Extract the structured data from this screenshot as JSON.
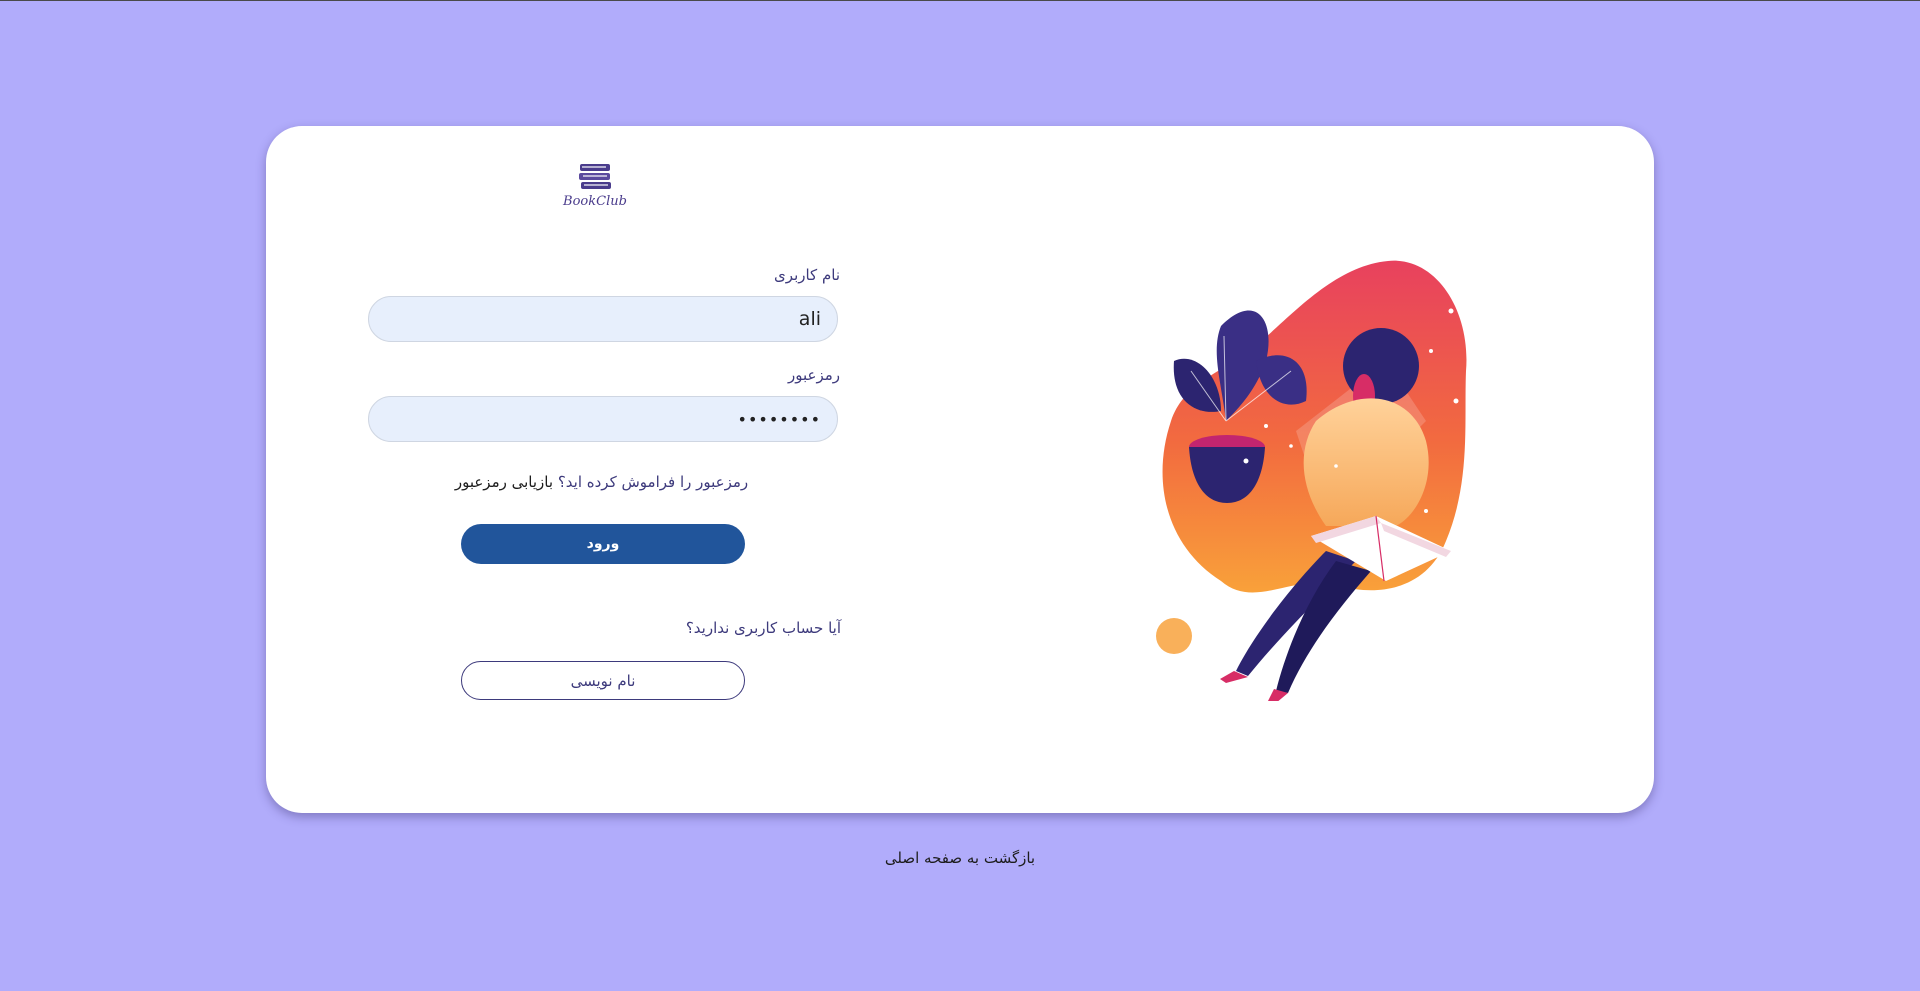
{
  "app": {
    "logo_text": "BookClub"
  },
  "form": {
    "username_label": "نام کاربری",
    "username_value": "ali",
    "password_label": "رمزعبور",
    "password_value": "••••••••",
    "forgot_question": "رمزعبور را فراموش کرده اید؟",
    "forgot_link": "بازیابی رمزعبور",
    "login_button": "ورود",
    "no_account_text": "آیا حساب کاربری ندارید؟",
    "signup_button": "نام نویسی"
  },
  "footer": {
    "back_home": "بازگشت به صفحه اصلی"
  },
  "colors": {
    "background": "#b1acfb",
    "primary": "#21559b",
    "text_accent": "#3d3a7c",
    "input_bg": "#e7effc"
  }
}
